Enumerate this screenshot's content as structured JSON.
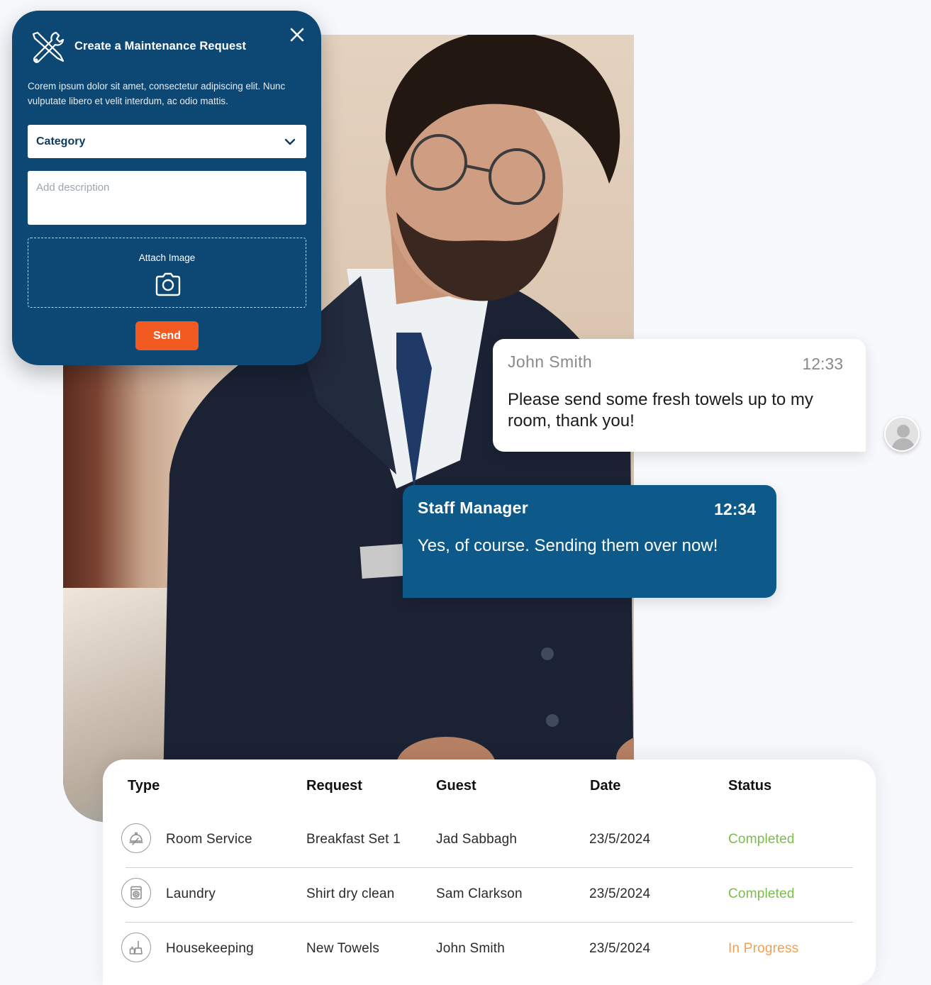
{
  "maintenance": {
    "title": "Create a Maintenance Request",
    "description": "Corem ipsum dolor sit amet, consectetur adipiscing elit. Nunc vulputate libero et velit interdum, ac  odio mattis.",
    "category_label": "Category",
    "description_placeholder": "Add description",
    "attach_label": "Attach Image",
    "send_label": "Send"
  },
  "chat": {
    "guest": {
      "name": "John Smith",
      "time": "12:33",
      "message": "Please send some fresh towels up to my room, thank you!"
    },
    "staff": {
      "name": "Staff Manager",
      "time": "12:34",
      "message": "Yes, of course. Sending them over now!"
    }
  },
  "table": {
    "headers": {
      "type": "Type",
      "request": "Request",
      "guest": "Guest",
      "date": "Date",
      "status": "Status"
    },
    "rows": [
      {
        "icon": "room-service-icon",
        "type": "Room Service",
        "request": "Breakfast Set 1",
        "guest": "Jad Sabbagh",
        "date": "23/5/2024",
        "status": "Completed"
      },
      {
        "icon": "laundry-icon",
        "type": "Laundry",
        "request": "Shirt dry clean",
        "guest": "Sam Clarkson",
        "date": "23/5/2024",
        "status": "Completed"
      },
      {
        "icon": "housekeeping-icon",
        "type": "Housekeeping",
        "request": "New Towels",
        "guest": "John Smith",
        "date": "23/5/2024",
        "status": "In Progress"
      }
    ]
  },
  "colors": {
    "card_navy": "#0d4773",
    "staff_bubble": "#0d5a8a",
    "send_orange": "#f25a22",
    "status_completed": "#7bbd4a",
    "status_in_progress": "#f0a050"
  }
}
